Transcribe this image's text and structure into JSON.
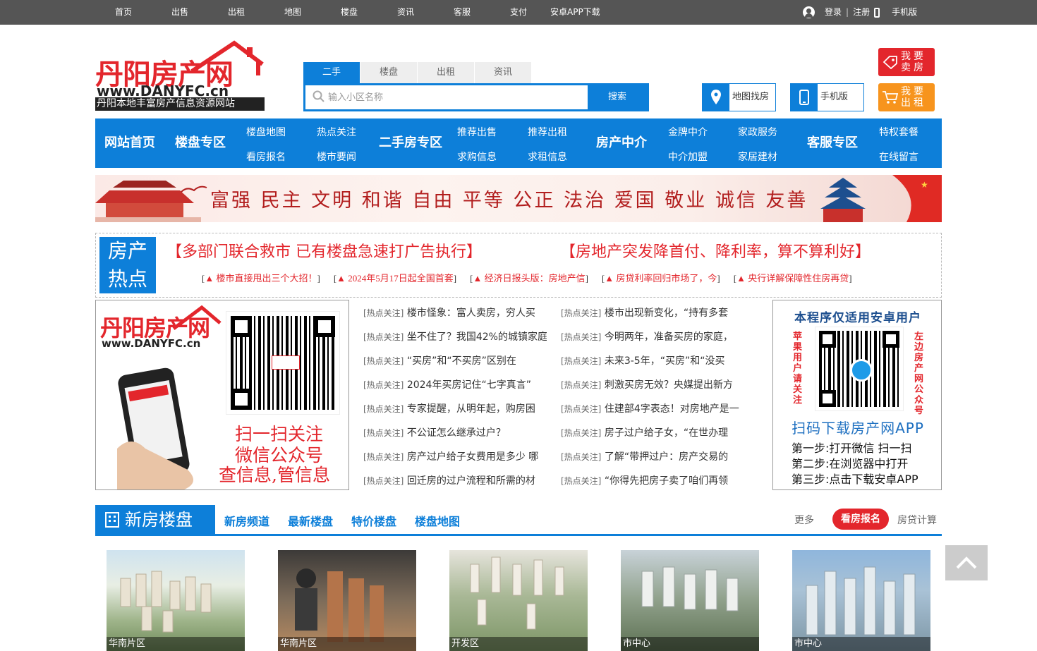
{
  "topbar": {
    "nav": [
      "首页",
      "出售",
      "出租",
      "地图",
      "楼盘",
      "资讯",
      "客服",
      "支付",
      "安卓APP下载"
    ],
    "login": "登录",
    "sep": "|",
    "register": "注册",
    "mobile": "手机版"
  },
  "logo": {
    "title": "丹阳房产网",
    "url": "www.DANYFC.cn",
    "slogan": "丹阳本地丰富房产信息资源网站"
  },
  "search": {
    "tabs": [
      "二手",
      "楼盘",
      "出租",
      "资讯"
    ],
    "active_tab": "二手",
    "placeholder": "输入小区名称",
    "button": "搜索"
  },
  "header_buttons": {
    "map": "地图找房",
    "mobile": "手机版",
    "sell": "我要卖房",
    "rent": "我要出租"
  },
  "main_nav": {
    "home": "网站首页",
    "loupan": "楼盘专区",
    "loupan_map": "楼盘地图",
    "hot_focus": "热点关注",
    "kanfang": "看房报名",
    "market_news": "楼市要闻",
    "second_hand": "二手房专区",
    "rec_sale": "推荐出售",
    "rec_rent": "推荐出租",
    "buy_info": "求购信息",
    "rent_info": "求租信息",
    "agency": "房产中介",
    "gold_agency": "金牌中介",
    "join_agency": "中介加盟",
    "home_service": "家政服务",
    "home_build": "家居建材",
    "service": "客服专区",
    "vip": "特权套餐",
    "message": "在线留言"
  },
  "banner": {
    "text": "富强 民主 文明 和谐  自由 平等 公正 法治  爱国 敬业 诚信 友善"
  },
  "hot": {
    "badge1": "房产",
    "badge2": "热点",
    "head1": "【多部门联合救市 已有楼盘急速打广告执行】",
    "head2": "【房地产突发降首付、降利率，算不算利好】",
    "links": [
      "▲ 楼市直接甩出三个大招！",
      "▲ 2024年5月17日起全国首套",
      "▲ 经济日报头版：房地产信",
      "▲ 房贷利率回归市场了，今",
      "▲ 央行详解保障性住房再贷"
    ]
  },
  "qr_left": {
    "logo": "丹阳房产网",
    "url": "www.DANYFC.cn",
    "line1": "扫一扫关注",
    "line2": "微信公众号",
    "line3": "查信息,管信息"
  },
  "news": {
    "tag": "[热点关注]",
    "col1": [
      "楼市怪象：富人卖房，穷人买",
      "坐不住了？我国42%的城镇家庭",
      "“买房”和“不买房”区别在",
      "2024年买房记住“七字真言”",
      "专家提醒，从明年起，购房困",
      "不公证怎么继承过户？",
      "房产过户给子女费用是多少 哪",
      "回迁房的过户流程和所需的材"
    ],
    "col2": [
      "楼市出现新变化，“持有多套",
      "今明两年，准备买房的家庭，",
      "未来3-5年，“买房”和“没买",
      "刺激买房无效？央媒提出新方",
      "住建部4字表态！对房地产是一",
      "房子过户给子女，“在世办理",
      "了解“带押过户：房产交易的",
      "“你得先把房子卖了咱们再领"
    ]
  },
  "qr_right": {
    "title": "本程序仅适用安卓用户",
    "left_vertical": "苹果用户请关注",
    "right_vertical": "左边房产网公众号",
    "scan": "扫码下载房产网APP",
    "step1": "第一步:打开微信 扫一扫",
    "step2": "第二步:在浏览器中打开",
    "step3": "第三步:点击下载安卓APP"
  },
  "new_houses": {
    "title": "新房楼盘",
    "links": [
      "新房频道",
      "最新楼盘",
      "特价楼盘",
      "楼盘地图"
    ],
    "more": "更多",
    "signup": "看房报名",
    "loan_calc": "房贷计算",
    "cards": [
      "华南片区",
      "华南片区",
      "开发区",
      "市中心",
      "市中心"
    ]
  },
  "colors": {
    "accent": "#0d7fd9",
    "red": "#e3262c",
    "orange": "#f7941d",
    "topbar": "#555555"
  }
}
